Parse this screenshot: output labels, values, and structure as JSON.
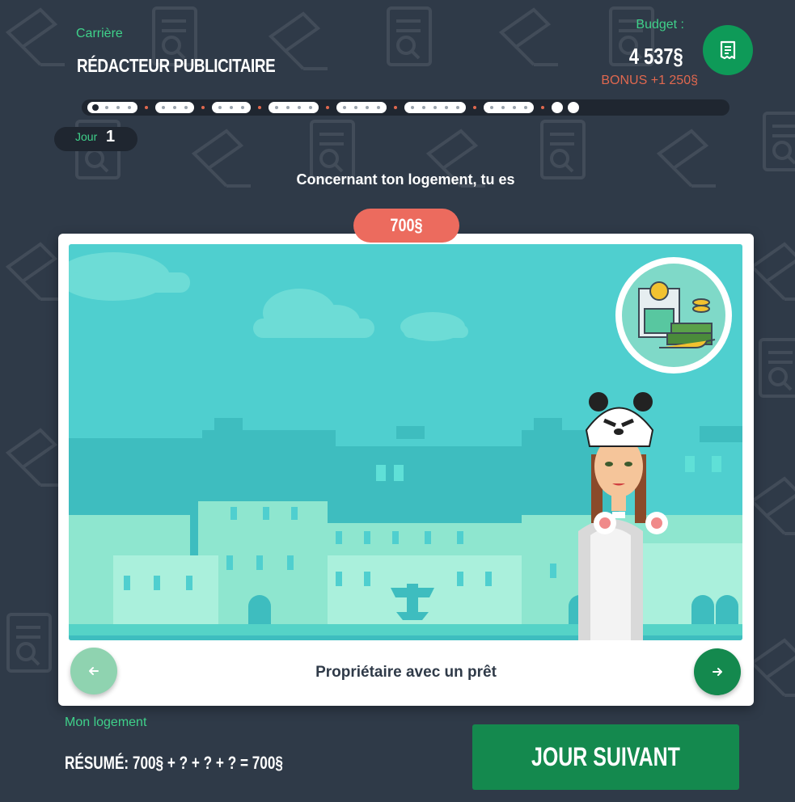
{
  "header": {
    "career_label": "Carrière",
    "career_title": "RÉDACTEUR PUBLICITAIRE",
    "budget_label": "Budget :",
    "budget_value": "4 537§",
    "budget_bonus": "BONUS +1 250§",
    "receipt_icon": "receipt-icon"
  },
  "progress": {
    "day_label": "Jour",
    "day_number": "1",
    "segment_dot_counts": [
      4,
      3,
      3,
      4,
      4,
      5,
      4
    ],
    "current_index": 0
  },
  "question": "Concernant ton logement, tu es",
  "choice": {
    "price": "700§",
    "option_label": "Propriétaire avec un prêt",
    "prev_icon": "arrow-left-icon",
    "next_icon": "arrow-right-icon",
    "badge_icon": "bank-loan-icon"
  },
  "footer": {
    "housing_label": "Mon logement",
    "summary": "RÉSUMÉ: 700§ + ? + ? + ? = 700§",
    "next_day_button": "JOUR SUIVANT"
  },
  "colors": {
    "background": "#2f3a48",
    "accent_green": "#14894e",
    "label_green": "#3fd18a",
    "price_red": "#ec6b5e",
    "sky": "#4fcfcf"
  }
}
